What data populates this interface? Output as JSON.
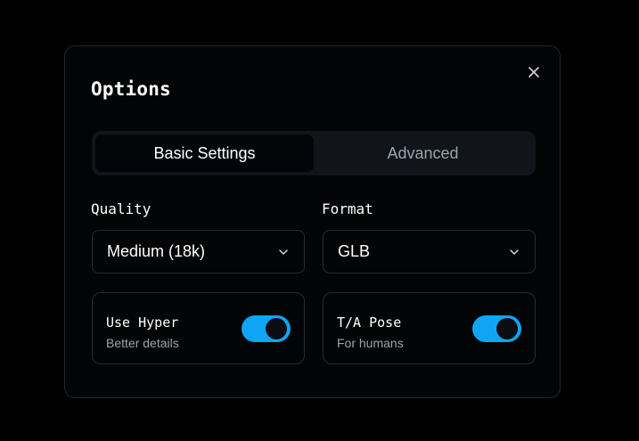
{
  "dialog": {
    "title": "Options",
    "close_icon": "close-icon"
  },
  "tabs": [
    {
      "label": "Basic Settings",
      "active": true
    },
    {
      "label": "Advanced",
      "active": false
    }
  ],
  "quality": {
    "label": "Quality",
    "value": "Medium (18k)",
    "icon": "chevron-down-icon"
  },
  "format": {
    "label": "Format",
    "value": "GLB",
    "icon": "chevron-down-icon"
  },
  "use_hyper": {
    "title": "Use Hyper",
    "subtitle": "Better details",
    "enabled": true
  },
  "ta_pose": {
    "title": "T/A Pose",
    "subtitle": "For humans",
    "enabled": true
  },
  "colors": {
    "background": "#000000",
    "dialog_bg": "#030405",
    "border": "#272a31",
    "accent": "#0ea5f5",
    "muted_text": "#9ca3af"
  }
}
